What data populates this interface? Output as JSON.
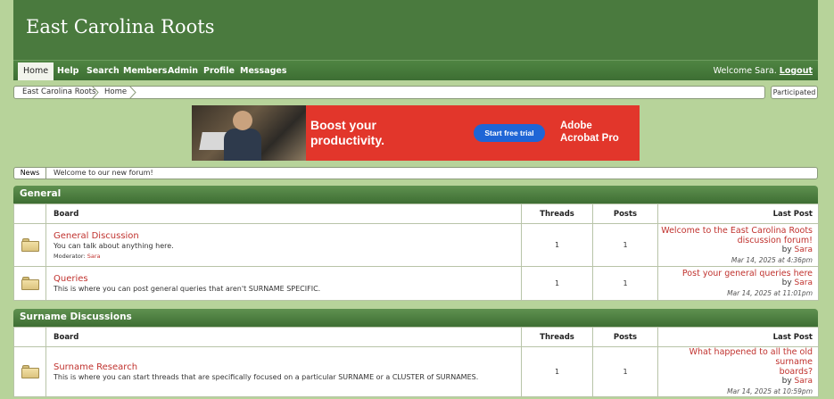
{
  "site": {
    "title": "East Carolina Roots"
  },
  "nav": {
    "items": [
      {
        "label": "Home"
      },
      {
        "label": "Help"
      },
      {
        "label": "Search"
      },
      {
        "label": "Members"
      },
      {
        "label": "Admin"
      },
      {
        "label": "Profile"
      },
      {
        "label": "Messages"
      }
    ],
    "welcome_text": "Welcome Sara.",
    "logout_label": "Logout"
  },
  "breadcrumb": {
    "items": [
      "East Carolina Roots",
      "Home"
    ],
    "participated_label": "Participated"
  },
  "ad": {
    "headline_1": "Boost your",
    "headline_2": "productivity.",
    "cta": "Start free trial",
    "brand_1": "Adobe",
    "brand_2": "Acrobat Pro"
  },
  "news": {
    "label": "News",
    "text": "Welcome to our new forum!"
  },
  "columns": {
    "board": "Board",
    "threads": "Threads",
    "posts": "Posts",
    "last_post": "Last Post"
  },
  "categories": [
    {
      "title": "General",
      "boards": [
        {
          "name": "General Discussion",
          "description": "You can talk about anything here.",
          "moderator_label": "Moderator:",
          "moderator": "Sara",
          "threads": "1",
          "posts": "1",
          "last_post_title_1": "Welcome to the East Carolina Roots",
          "last_post_title_2": "discussion forum!",
          "last_post_by": "by",
          "last_post_user": "Sara",
          "last_post_date": "Mar 14, 2025 at 4:36pm"
        },
        {
          "name": "Queries",
          "description": "This is where you can post general queries that aren't SURNAME SPECIFIC.",
          "threads": "1",
          "posts": "1",
          "last_post_title_1": "Post your general queries here",
          "last_post_by": "by",
          "last_post_user": "Sara",
          "last_post_date": "Mar 14, 2025 at 11:01pm"
        }
      ]
    },
    {
      "title": "Surname Discussions",
      "boards": [
        {
          "name": "Surname Research",
          "description": "This is where you can start threads that are specifically focused on a particular SURNAME or a CLUSTER of SURNAMES.",
          "threads": "1",
          "posts": "1",
          "last_post_title_1": "What happened to all the old surname",
          "last_post_title_2": "boards?",
          "last_post_by": "by",
          "last_post_user": "Sara",
          "last_post_date": "Mar 14, 2025 at 10:59pm"
        }
      ]
    }
  ],
  "colors": {
    "header": "#4a7a3e",
    "background": "#b7d39a",
    "link": "#c0322e"
  }
}
